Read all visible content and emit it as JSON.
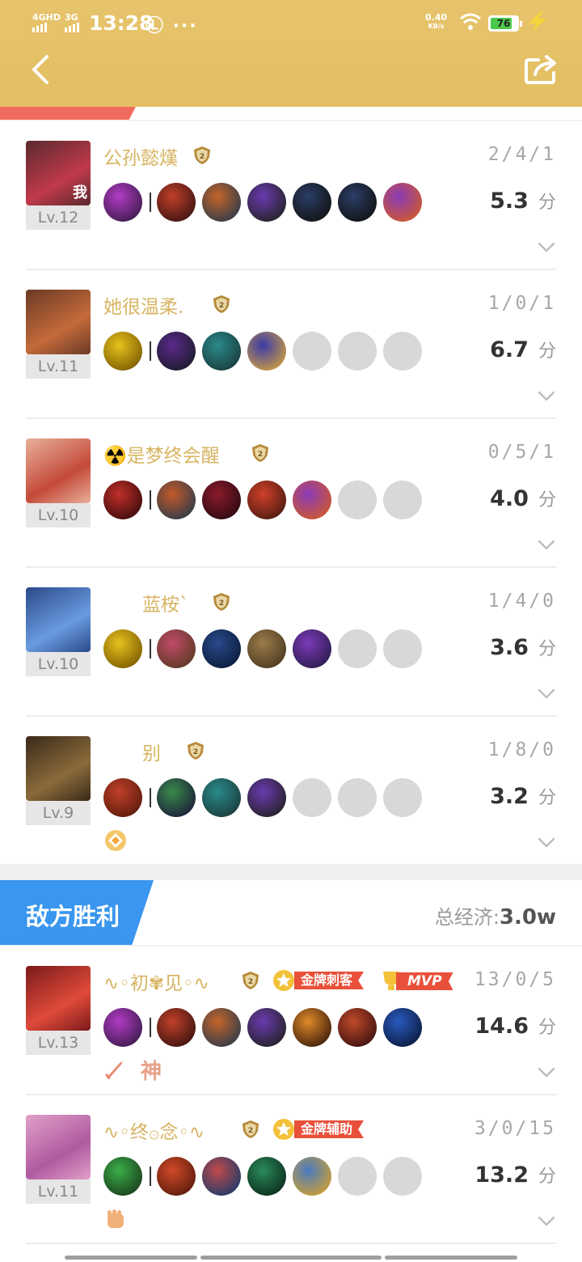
{
  "status_bar": {
    "network_1": "4GHD",
    "network_2": "3G",
    "time": "13:28",
    "extra": "Ⓛ ···",
    "net_speed_value": "0.40",
    "net_speed_unit": "KB/s",
    "battery": "76"
  },
  "header": {
    "back_icon": "chevron-left-icon",
    "share_icon": "share-icon"
  },
  "our_team": [
    {
      "name": "公孙懿熯",
      "level": "Lv.12",
      "me_tag": "我",
      "kda": "2/4/1",
      "score": "5.3",
      "unit": "分",
      "portrait": [
        "#5a2a2e",
        "#c0394b"
      ],
      "items": [
        [
          "#b23cc4",
          "#3a1a4a"
        ],
        [
          "#c0402a",
          "#3b1210"
        ],
        [
          "#c4642a",
          "#2c3a4a"
        ],
        [
          "#6a3ab0",
          "#222"
        ],
        [
          "#2a3e66",
          "#111"
        ],
        [
          "#2a3e66",
          "#111"
        ],
        [
          "#8a3ab8",
          "#d05a2a"
        ]
      ],
      "rank_color": "#b68a3a"
    },
    {
      "name": "她很温柔.",
      "level": "Lv.11",
      "kda": "1/0/1",
      "score": "6.7",
      "unit": "分",
      "portrait": [
        "#6b3a26",
        "#c46a3a"
      ],
      "items": [
        [
          "#e7c21e",
          "#7a5a00"
        ],
        [
          "#5a2a8a",
          "#1a1a2a"
        ],
        [
          "#2a8a8a",
          "#1a3a3a"
        ],
        [
          "#3a3aa8",
          "#d0a040"
        ],
        null,
        null,
        null
      ],
      "rank_color": "#b68a3a"
    },
    {
      "name": "☢️是梦终会醒",
      "level": "Lv.10",
      "kda": "0/5/1",
      "score": "4.0",
      "unit": "分",
      "portrait": [
        "#e8b09a",
        "#c44a3a"
      ],
      "items": [
        [
          "#c0302a",
          "#3a0a0a"
        ],
        [
          "#c45a2a",
          "#2a3a4a"
        ],
        [
          "#8a1a2a",
          "#2a0a10"
        ],
        [
          "#d0402a",
          "#4a1a10"
        ],
        [
          "#8a3ab8",
          "#d05a2a"
        ],
        null,
        null
      ],
      "rank_color": "#b68a3a"
    },
    {
      "name": "蓝桉`",
      "level": "Lv.10",
      "kda": "1/4/0",
      "score": "3.6",
      "unit": "分",
      "portrait": [
        "#2a4a8a",
        "#6a9ae0"
      ],
      "items": [
        [
          "#e7c21e",
          "#7a5a00"
        ],
        [
          "#c04a6a",
          "#5a3a20"
        ],
        [
          "#2a4a8a",
          "#0a1a3a"
        ],
        [
          "#9a7a4a",
          "#4a3a20"
        ],
        [
          "#7a3ab8",
          "#2a1a4a"
        ],
        null,
        null
      ],
      "rank_color": "#b68a3a",
      "name_indent": true
    },
    {
      "name": "别",
      "level": "Lv.9",
      "kda": "1/8/0",
      "score": "3.2",
      "unit": "分",
      "portrait": [
        "#3a2a1a",
        "#8a6a3a"
      ],
      "items": [
        [
          "#c0402a",
          "#5a1a0a"
        ],
        [
          "#3a8a4a",
          "#1a1a3a"
        ],
        [
          "#2a8a8a",
          "#1a3a3a"
        ],
        [
          "#6a3ab0",
          "#222"
        ],
        null,
        null,
        null
      ],
      "rank_color": "#b68a3a",
      "name_indent": true,
      "extra_icon": "diamond-badge-icon"
    }
  ],
  "enemy": {
    "tab_label": "敌方胜利",
    "econ_label": "总经济:",
    "econ_value": "3.0w"
  },
  "enemy_team": [
    {
      "name": "∿◦初✾见◦∿",
      "level": "Lv.13",
      "kda": "13/0/5",
      "score": "14.6",
      "unit": "分",
      "portrait": [
        "#7a1a1a",
        "#e04a3a"
      ],
      "items": [
        [
          "#b23cc4",
          "#3a1a4a"
        ],
        [
          "#c0402a",
          "#3b1210"
        ],
        [
          "#c4642a",
          "#2c3a4a"
        ],
        [
          "#6a3ab0",
          "#222"
        ],
        [
          "#e08a2a",
          "#3a1a0a"
        ],
        [
          "#c04a2a",
          "#3a1010"
        ],
        [
          "#2a5ac0",
          "#0a1a3a"
        ]
      ],
      "medal": "金牌刺客",
      "mvp": "MVP",
      "badge_text": "神",
      "rank_color": "#b68a3a"
    },
    {
      "name": "∿◦终۞念◦∿",
      "level": "Lv.11",
      "kda": "3/0/15",
      "score": "13.2",
      "unit": "分",
      "portrait": [
        "#e0a0c8",
        "#b05aa0"
      ],
      "items": [
        [
          "#3ab04a",
          "#1a3a1a"
        ],
        [
          "#d04a2a",
          "#5a1a0a"
        ],
        [
          "#c04a4a",
          "#1a3a6a"
        ],
        [
          "#2a8a5a",
          "#0a2a1a"
        ],
        [
          "#4a7ac0",
          "#d0a030"
        ],
        null,
        null
      ],
      "medal": "金牌辅助",
      "rank_color": "#b68a3a",
      "extra_icon": "fist-icon"
    }
  ]
}
